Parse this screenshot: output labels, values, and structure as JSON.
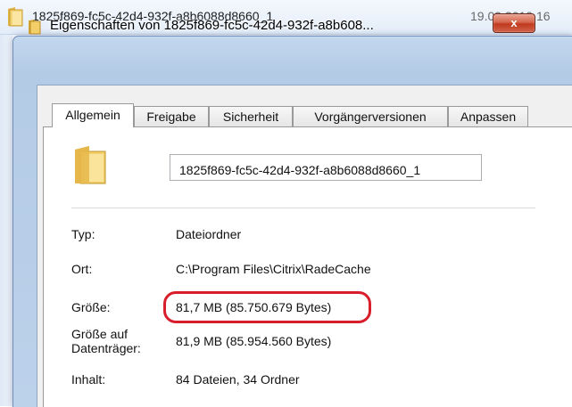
{
  "explorer": {
    "folder_name": "1825f869-fc5c-42d4-932f-a8b6088d8660_1",
    "date": "19.09.2010 16"
  },
  "dialog": {
    "title": "Eigenschaften von 1825f869-fc5c-42d4-932f-a8b608...",
    "close_label": "x",
    "tabs": [
      {
        "label": "Allgemein",
        "active": true
      },
      {
        "label": "Freigabe",
        "active": false
      },
      {
        "label": "Sicherheit",
        "active": false
      },
      {
        "label": "Vorgängerversionen",
        "active": false
      },
      {
        "label": "Anpassen",
        "active": false
      }
    ],
    "name_value": "1825f869-fc5c-42d4-932f-a8b6088d8660_1",
    "properties": {
      "typ_label": "Typ:",
      "typ_value": "Dateiordner",
      "ort_label": "Ort:",
      "ort_value": "C:\\Program Files\\Citrix\\RadeCache",
      "groesse_label": "Größe:",
      "groesse_value": "81,7 MB (85.750.679 Bytes)",
      "groesse_auf_label_1": "Größe auf",
      "groesse_auf_label_2": "Datenträger:",
      "groesse_auf_value": "81,9 MB (85.954.560 Bytes)",
      "inhalt_label": "Inhalt:",
      "inhalt_value": "84 Dateien, 34 Ordner"
    }
  },
  "colors": {
    "highlight": "#d81e2a",
    "title_bar": "#b4cbe6",
    "close_button": "#c0391e"
  },
  "icons": [
    "folder-icon",
    "close-icon"
  ]
}
